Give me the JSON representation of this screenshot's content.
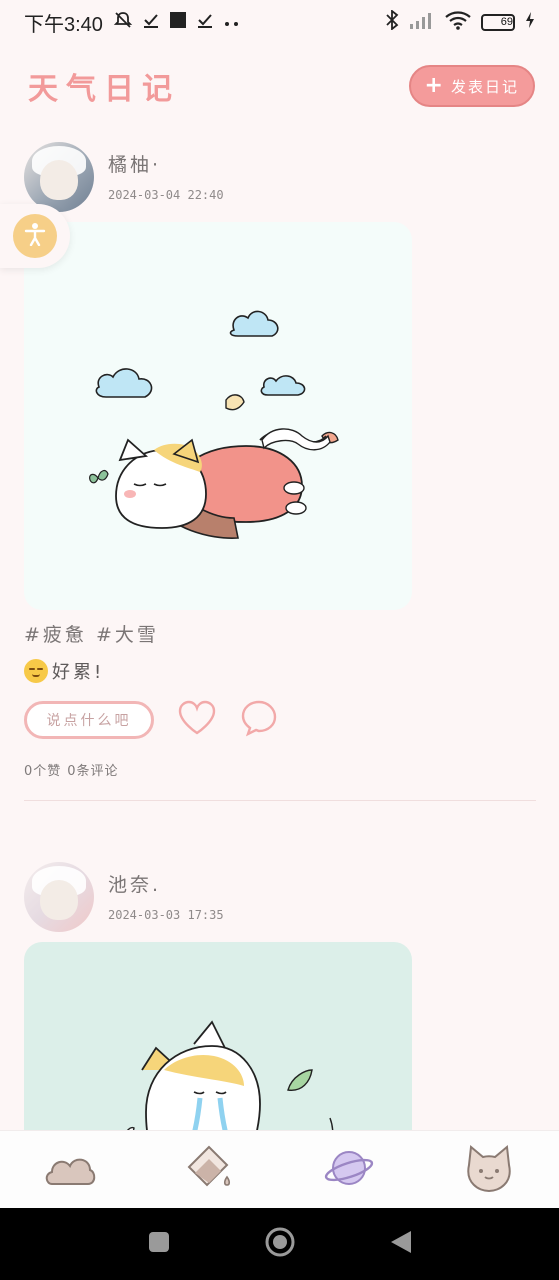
{
  "status_bar": {
    "time": "下午3:40",
    "battery_level": "69",
    "icons": [
      "mute-icon",
      "check-icon",
      "square-icon",
      "check-icon",
      "more-dots-icon",
      "bluetooth-icon",
      "signal-icon",
      "wifi-icon",
      "battery-icon",
      "charging-icon"
    ]
  },
  "header": {
    "title": "天气日记",
    "post_button_label": "发表日记"
  },
  "floating_button": {
    "icon": "accessibility-icon"
  },
  "posts": [
    {
      "user": "橘柚·",
      "time": "2024-03-04 22:40",
      "tags": "#疲惫 #大雪",
      "content": "好累!",
      "comment_placeholder": "说点什么吧",
      "likes": "0个赞",
      "comments": "0条评论"
    },
    {
      "user": "池奈.",
      "time": "2024-03-03 17:35"
    }
  ],
  "bottom_nav": {
    "items": [
      "cloud-icon",
      "brush-bucket-icon",
      "planet-icon",
      "cat-face-icon"
    ]
  },
  "colors": {
    "accent": "#f49b9b",
    "background": "#fdf6f6",
    "title": "#f29a9a"
  }
}
